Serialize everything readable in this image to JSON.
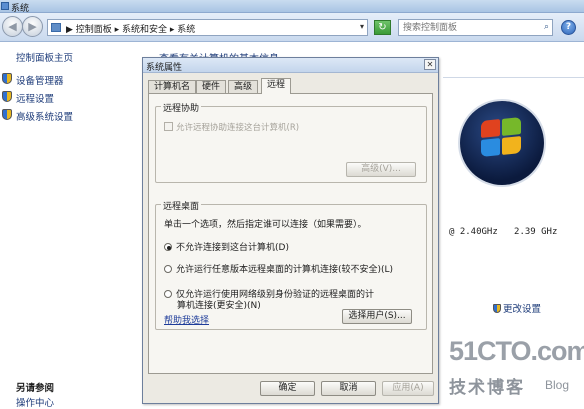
{
  "window": {
    "title": "系统",
    "address": "▶ 控制面板 ▸ 系统和安全 ▸ 系统",
    "search_placeholder": "搜索控制面板"
  },
  "nav": {
    "back": "◀",
    "forward": "▶",
    "refresh": "↻",
    "help": "?",
    "dropdown": "▾",
    "search_icon": "⌕"
  },
  "left_pane": {
    "home": "控制面板主页",
    "links": [
      "设备管理器",
      "远程设置",
      "高级系统设置"
    ],
    "see_also": "另请参阅",
    "see_also_cut": "操作中心"
  },
  "main_pane": {
    "heading": "查看有关计算机的基本信息",
    "cpu": "@ 2.40GHz   2.39 GHz",
    "change_settings": "更改设置"
  },
  "watermark": {
    "site": "51CTO.com",
    "blog_cn": "技术博客",
    "blog_en": "Blog"
  },
  "dialog": {
    "title": "系统属性",
    "close": "✕",
    "tabs": [
      "计算机名",
      "硬件",
      "高级",
      "远程"
    ],
    "active_tab": 3,
    "assist": {
      "group_label": "远程协助",
      "checkbox_label": "允许远程协助连接这台计算机(R)",
      "advanced_button": "高级(V)..."
    },
    "desktop": {
      "group_label": "远程桌面",
      "description": "单击一个选项，然后指定谁可以连接（如果需要）。",
      "options": [
        "不允许连接到这台计算机(D)",
        "允许运行任意版本远程桌面的计算机连接(较不安全)(L)",
        "仅允许运行使用网络级别身份验证的远程桌面的计"
      ],
      "option3_line2": "算机连接(更安全)(N)",
      "selected": 0,
      "help_link": "帮助我选择",
      "select_users_button": "选择用户(S)..."
    },
    "buttons": {
      "ok": "确定",
      "cancel": "取消",
      "apply": "应用(A)"
    }
  },
  "colors": {
    "accent": "#1e3c7a",
    "dialog_bg": "#eceae3",
    "titlebar": "#c3d5ec"
  }
}
